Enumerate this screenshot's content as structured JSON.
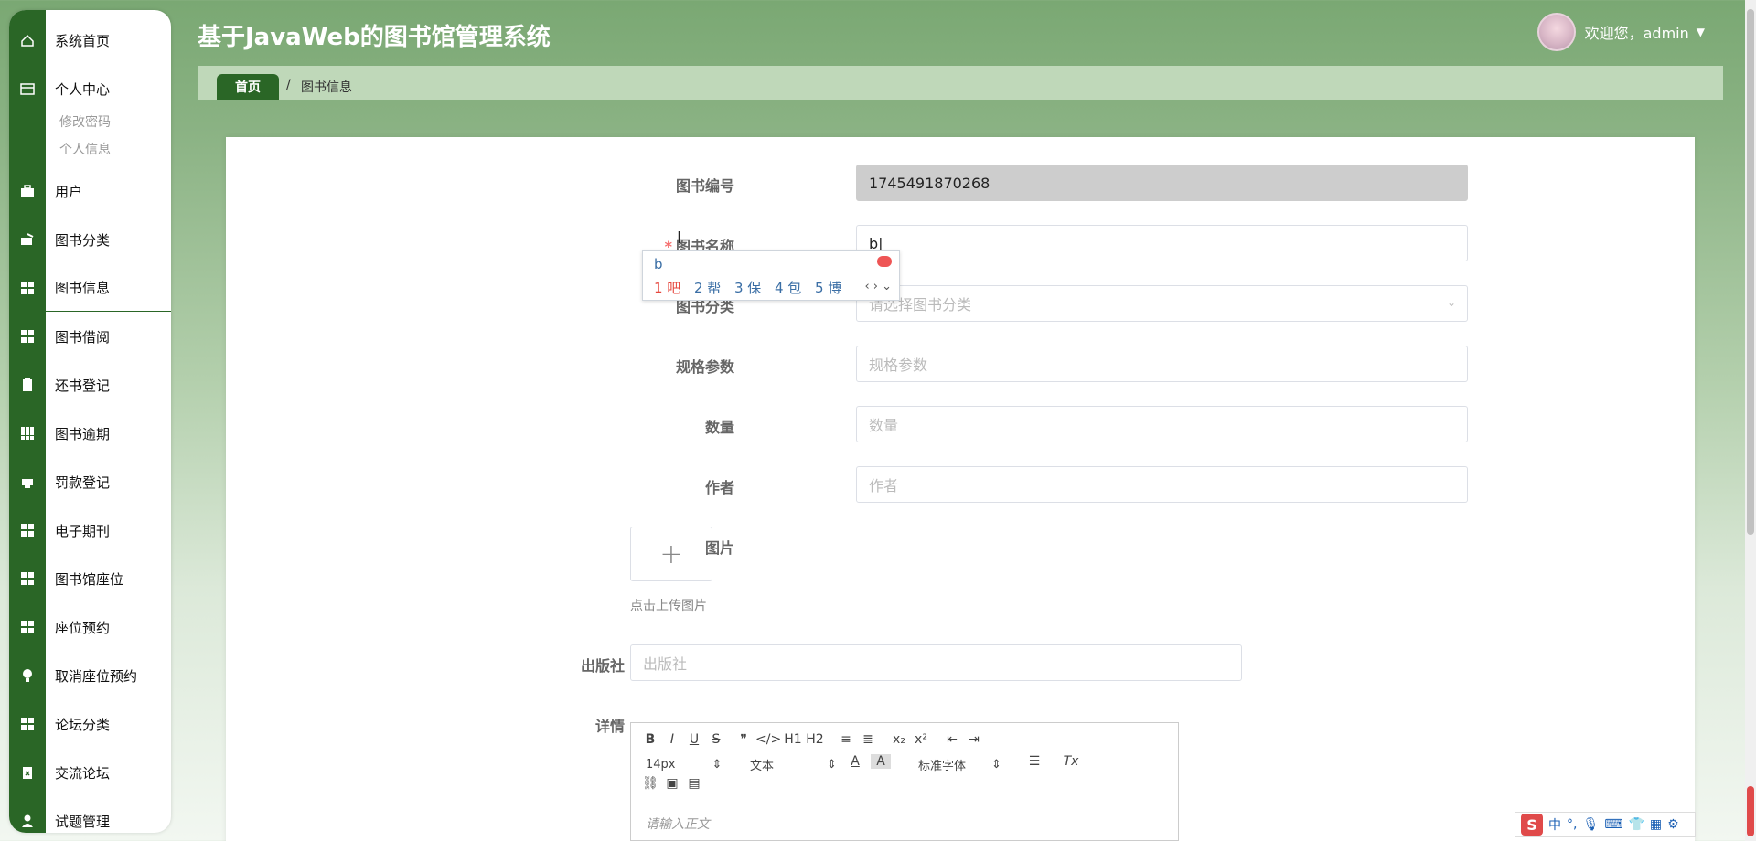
{
  "app": {
    "title": "基于JavaWeb的图书馆管理系统"
  },
  "user": {
    "greeting": "欢迎您，admin"
  },
  "breadcrumb": {
    "home": "首页",
    "separator": "/",
    "current": "图书信息"
  },
  "sidebar": {
    "items": [
      {
        "label": "系统首页",
        "icon": "home-icon"
      },
      {
        "label": "个人中心",
        "icon": "wallet-icon"
      },
      {
        "label": "用户",
        "icon": "briefcase-icon"
      },
      {
        "label": "图书分类",
        "icon": "wallet-out-icon"
      },
      {
        "label": "图书信息",
        "icon": "grid-icon"
      },
      {
        "label": "图书借阅",
        "icon": "grid-icon"
      },
      {
        "label": "还书登记",
        "icon": "clipboard-icon"
      },
      {
        "label": "图书逾期",
        "icon": "grid-9-icon"
      },
      {
        "label": "罚款登记",
        "icon": "printer-icon"
      },
      {
        "label": "电子期刊",
        "icon": "grid-icon"
      },
      {
        "label": "图书馆座位",
        "icon": "grid-icon"
      },
      {
        "label": "座位预约",
        "icon": "grid-icon"
      },
      {
        "label": "取消座位预约",
        "icon": "bulb-icon"
      },
      {
        "label": "论坛分类",
        "icon": "grid-icon"
      },
      {
        "label": "交流论坛",
        "icon": "clipboard-x-icon"
      },
      {
        "label": "试题管理",
        "icon": "user-icon"
      }
    ],
    "subitems": [
      "修改密码",
      "个人信息"
    ]
  },
  "form": {
    "book_no": {
      "label": "图书编号",
      "value": "1745491870268"
    },
    "book_name": {
      "label": "图书名称",
      "required": "*",
      "value": "b"
    },
    "category": {
      "label": "图书分类",
      "placeholder": "请选择图书分类"
    },
    "spec": {
      "label": "规格参数",
      "placeholder": "规格参数"
    },
    "quantity": {
      "label": "数量",
      "placeholder": "数量"
    },
    "author": {
      "label": "作者",
      "placeholder": "作者"
    },
    "image": {
      "label": "图片",
      "plus": "+",
      "tip": "点击上传图片"
    },
    "publisher": {
      "label": "出版社",
      "placeholder": "出版社"
    },
    "detail": {
      "label": "详情",
      "placeholder": "请输入正文"
    }
  },
  "editor": {
    "row1": [
      "B",
      "I",
      "U",
      "S",
      "❞",
      "</>",
      "H1",
      "H2",
      "≡",
      "≣",
      "x₂",
      "x²",
      "⇤",
      "⇥"
    ],
    "font_size": "14px",
    "block_type": "文本",
    "font_family": "标准字体",
    "clear_format": "Tx"
  },
  "ime": {
    "pinyin": "b",
    "candidates": [
      "1 吧",
      "2 帮",
      "3 保",
      "4 包",
      "5 博"
    ],
    "nav": "‹ › ⌄"
  },
  "imebar": {
    "logo": "S",
    "mode": "中"
  }
}
